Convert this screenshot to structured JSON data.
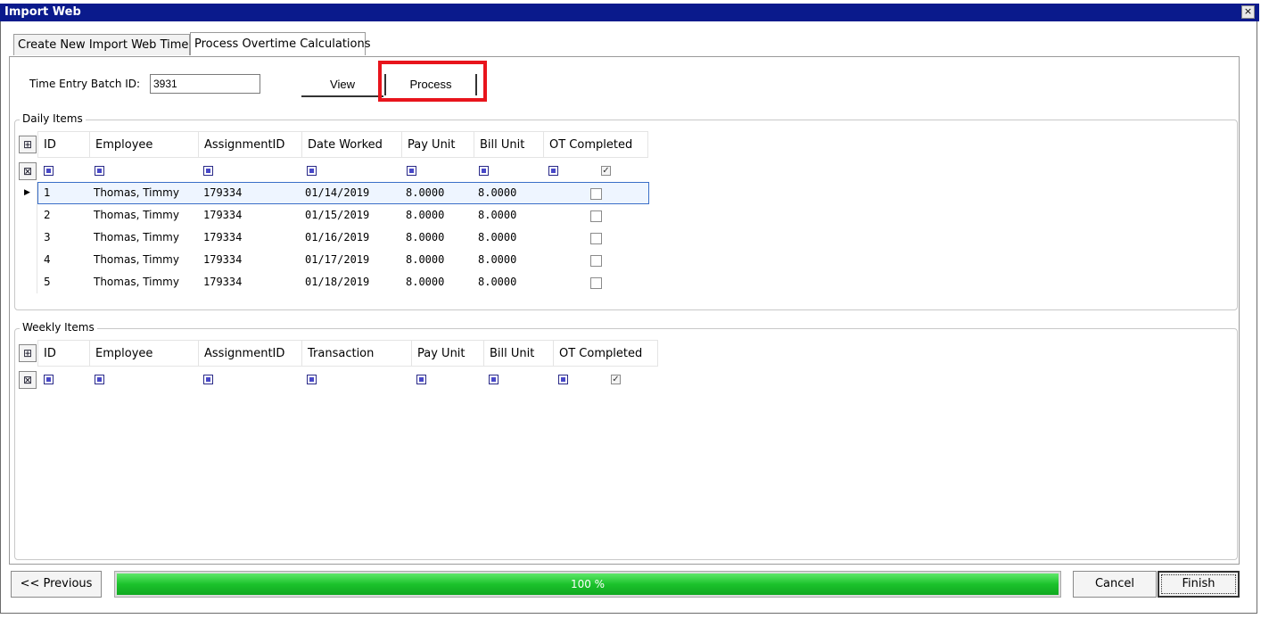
{
  "window": {
    "title": "Import Web",
    "close_glyph": "×"
  },
  "tabs": [
    {
      "label": "Create New Import Web Time",
      "active": false
    },
    {
      "label": "Process Overtime Calculations",
      "active": true
    }
  ],
  "batch": {
    "label": "Time Entry Batch ID:",
    "value": "3931"
  },
  "actions": {
    "view_label": "View",
    "process_label": "Process"
  },
  "daily": {
    "title": "Daily Items",
    "columns": [
      "ID",
      "Employee",
      "AssignmentID",
      "Date Worked",
      "Pay Unit",
      "Bill Unit",
      "OT Completed"
    ],
    "rows": [
      {
        "id": "1",
        "employee": "Thomas, Timmy",
        "assignment": "179334",
        "date": "01/14/2019",
        "pay": "8.0000",
        "bill": "8.0000",
        "ot": false
      },
      {
        "id": "2",
        "employee": "Thomas, Timmy",
        "assignment": "179334",
        "date": "01/15/2019",
        "pay": "8.0000",
        "bill": "8.0000",
        "ot": false
      },
      {
        "id": "3",
        "employee": "Thomas, Timmy",
        "assignment": "179334",
        "date": "01/16/2019",
        "pay": "8.0000",
        "bill": "8.0000",
        "ot": false
      },
      {
        "id": "4",
        "employee": "Thomas, Timmy",
        "assignment": "179334",
        "date": "01/17/2019",
        "pay": "8.0000",
        "bill": "8.0000",
        "ot": false
      },
      {
        "id": "5",
        "employee": "Thomas, Timmy",
        "assignment": "179334",
        "date": "01/18/2019",
        "pay": "8.0000",
        "bill": "8.0000",
        "ot": false
      }
    ]
  },
  "weekly": {
    "title": "Weekly Items",
    "columns": [
      "ID",
      "Employee",
      "AssignmentID",
      "Transaction",
      "Pay Unit",
      "Bill Unit",
      "OT Completed"
    ]
  },
  "footer": {
    "previous_label": "<< Previous",
    "progress_text": "100 %",
    "progress_fraction": 1.0,
    "cancel_label": "Cancel",
    "finish_label": "Finish"
  },
  "colors": {
    "title_bar": "#0a1a8c",
    "highlight": "#e8141c",
    "progress": "#1cc22c"
  },
  "icons": {
    "selected_row": "row-pointer-icon",
    "column_chooser": "column-chooser-icon",
    "filter_row": "filter-icon"
  }
}
